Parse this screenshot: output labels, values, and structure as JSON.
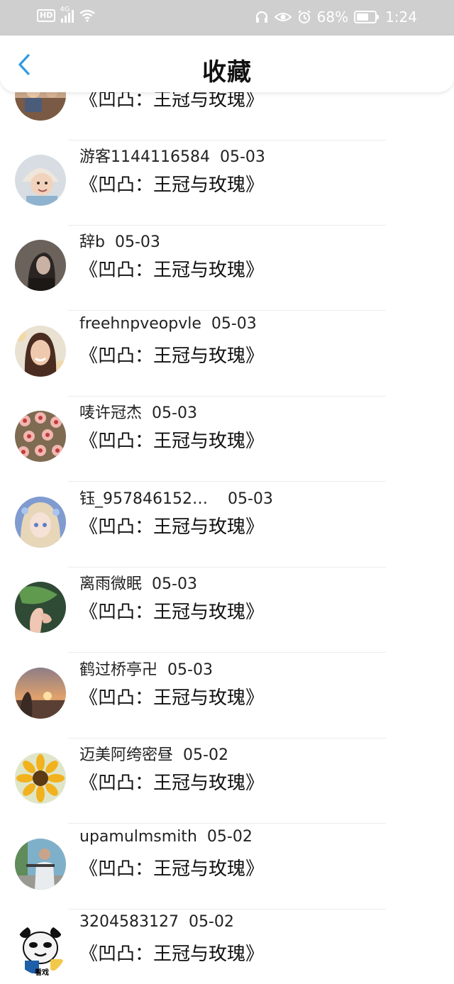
{
  "status_bar": {
    "hd": "HD",
    "net": "4G",
    "battery_text": "68%",
    "battery_level": 0.68,
    "time": "1:24"
  },
  "header": {
    "title": "收藏"
  },
  "colors": {
    "accent": "#2f9be3",
    "status_bar_bg": "#cfcfcf"
  },
  "items": [
    {
      "name": "",
      "date": "",
      "book": "《凹凸：王冠与玫瑰》",
      "avatar": "photo-people-icon"
    },
    {
      "name": "游客1144116584",
      "date": "05-03",
      "book": "《凹凸：王冠与玫瑰》",
      "avatar": "baby-photo-icon"
    },
    {
      "name": "辞b",
      "date": "05-03",
      "book": "《凹凸：王冠与玫瑰》",
      "avatar": "dark-portrait-icon"
    },
    {
      "name": "freehnpveopvle",
      "date": "05-03",
      "book": "《凹凸：王冠与玫瑰》",
      "avatar": "woman-portrait-icon"
    },
    {
      "name": "唛许冠杰",
      "date": "05-03",
      "book": "《凹凸：王冠与玫瑰》",
      "avatar": "flowers-icon"
    },
    {
      "name": "钰_957846152…",
      "date": "05-03",
      "book": "《凹凸：王冠与玫瑰》",
      "avatar": "anime-girl-icon"
    },
    {
      "name": "离雨微眠",
      "date": "05-03",
      "book": "《凹凸：王冠与玫瑰》",
      "avatar": "hand-leaf-icon"
    },
    {
      "name": "鹤过桥亭卍",
      "date": "05-03",
      "book": "《凹凸：王冠与玫瑰》",
      "avatar": "sunset-icon"
    },
    {
      "name": "迈美阿绔密昼",
      "date": "05-02",
      "book": "《凹凸：王冠与玫瑰》",
      "avatar": "sunflower-icon"
    },
    {
      "name": "upamulmsmith",
      "date": "05-02",
      "book": "《凹凸：王冠与玫瑰》",
      "avatar": "man-outdoor-icon"
    },
    {
      "name": "3204583127",
      "date": "05-02",
      "book": "《凹凸：王冠与玫瑰》",
      "avatar": "panda-meme-icon",
      "avatar_caption": "看戏"
    }
  ]
}
